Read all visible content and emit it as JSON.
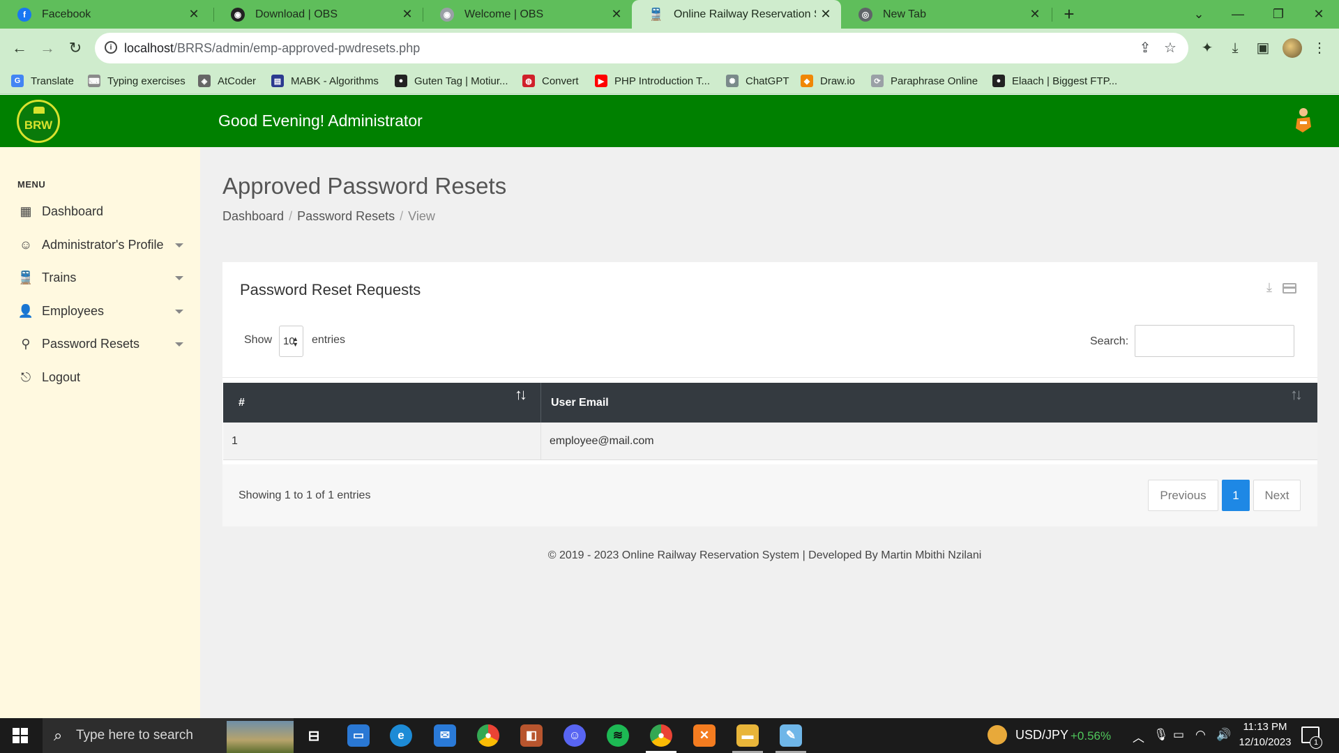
{
  "browser": {
    "tabs": [
      {
        "title": "Facebook",
        "icon": "facebook-icon",
        "color": "#1877f2"
      },
      {
        "title": "Download | OBS",
        "icon": "obs-icon",
        "color": "#222222"
      },
      {
        "title": "Welcome | OBS",
        "icon": "obs-icon",
        "color": "#9aa0a6"
      },
      {
        "title": "Online Railway Reservation System",
        "icon": "train-icon",
        "color": "#222222",
        "active": true
      },
      {
        "title": "New Tab",
        "icon": "chrome-icon",
        "color": "#5f6368"
      }
    ],
    "url_host": "localhost",
    "url_path": "/BRRS/admin/emp-approved-pwdresets.php",
    "bookmarks": [
      {
        "label": "Translate",
        "icon": "google-translate-icon",
        "color": "#4285f4"
      },
      {
        "label": "Typing exercises",
        "icon": "keyboard-icon",
        "color": "#8a8a8a"
      },
      {
        "label": "AtCoder",
        "icon": "atcoder-icon",
        "color": "#666666"
      },
      {
        "label": "MABK - Algorithms",
        "icon": "mabk-icon",
        "color": "#2b3a8f"
      },
      {
        "label": "Guten Tag | Motiur...",
        "icon": "github-icon",
        "color": "#222222"
      },
      {
        "label": "Convert",
        "icon": "convert-icon",
        "color": "#d0202a"
      },
      {
        "label": "PHP Introduction T...",
        "icon": "youtube-icon",
        "color": "#ff0000"
      },
      {
        "label": "ChatGPT",
        "icon": "chatgpt-icon",
        "color": "#7a8a8a"
      },
      {
        "label": "Draw.io",
        "icon": "drawio-icon",
        "color": "#f08705"
      },
      {
        "label": "Paraphrase Online",
        "icon": "paraphrase-icon",
        "color": "#9aa0a6"
      },
      {
        "label": "Elaach | Biggest FTP...",
        "icon": "github-icon",
        "color": "#222222"
      }
    ]
  },
  "app": {
    "logo_text": "BRW",
    "greeting": "Good Evening! Administrator",
    "menu_title": "MENU",
    "menu": [
      {
        "label": "Dashboard",
        "icon": "dashboard-icon",
        "caret": false
      },
      {
        "label": "Administrator's Profile",
        "icon": "profile-icon",
        "caret": true
      },
      {
        "label": "Trains",
        "icon": "train-icon",
        "caret": true
      },
      {
        "label": "Employees",
        "icon": "employees-icon",
        "caret": true
      },
      {
        "label": "Password Resets",
        "icon": "key-icon",
        "caret": true
      },
      {
        "label": "Logout",
        "icon": "logout-icon",
        "caret": false
      }
    ],
    "page_title": "Approved Password Resets",
    "breadcrumb": [
      "Dashboard",
      "Password Resets",
      "View"
    ],
    "card": {
      "title": "Password Reset Requests",
      "show_label": "Show",
      "page_length": "10",
      "entries_label": "entries",
      "search_label": "Search:",
      "search_value": "",
      "columns": [
        "#",
        "User Email"
      ],
      "rows": [
        {
          "num": "1",
          "email": "employee@mail.com"
        }
      ],
      "info": "Showing 1 to 1 of 1 entries",
      "pagination": {
        "previous": "Previous",
        "current": "1",
        "next": "Next"
      }
    },
    "footer": "© 2019 - 2023 Online Railway Reservation System | Developed By Martin Mbithi Nzilani"
  },
  "taskbar": {
    "search_placeholder": "Type here to search",
    "fx_pair": "USD/JPY",
    "fx_change": "+0.56%",
    "time": "11:13 PM",
    "date": "12/10/2023",
    "notifications": "1"
  },
  "colors": {
    "header_green": "#008000",
    "sidebar_bg": "#fff9e0",
    "table_head": "#343a40",
    "page_active": "#1e88e5"
  }
}
